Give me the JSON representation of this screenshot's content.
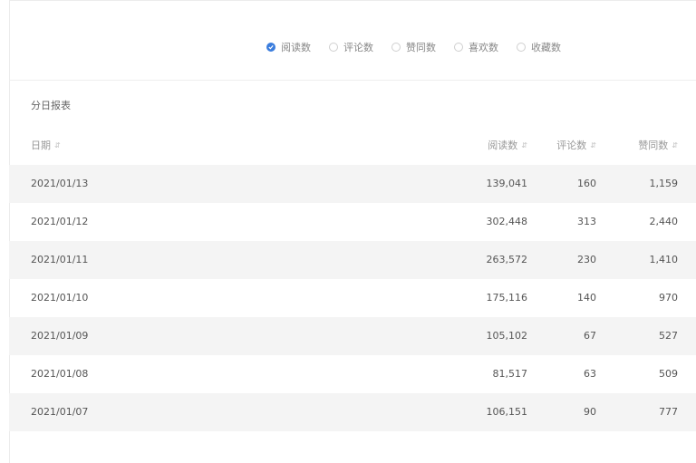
{
  "metrics": [
    {
      "label": "阅读数",
      "checked": true
    },
    {
      "label": "评论数",
      "checked": false
    },
    {
      "label": "赞同数",
      "checked": false
    },
    {
      "label": "喜欢数",
      "checked": false
    },
    {
      "label": "收藏数",
      "checked": false
    }
  ],
  "section_title": "分日报表",
  "table": {
    "headers": {
      "date": "日期",
      "reads": "阅读数",
      "comments": "评论数",
      "likes": "赞同数"
    },
    "sort_icon": "sort-icon",
    "rows": [
      {
        "date": "2021/01/13",
        "reads": "139,041",
        "comments": "160",
        "likes": "1,159"
      },
      {
        "date": "2021/01/12",
        "reads": "302,448",
        "comments": "313",
        "likes": "2,440"
      },
      {
        "date": "2021/01/11",
        "reads": "263,572",
        "comments": "230",
        "likes": "1,410"
      },
      {
        "date": "2021/01/10",
        "reads": "175,116",
        "comments": "140",
        "likes": "970"
      },
      {
        "date": "2021/01/09",
        "reads": "105,102",
        "comments": "67",
        "likes": "527"
      },
      {
        "date": "2021/01/08",
        "reads": "81,517",
        "comments": "63",
        "likes": "509"
      },
      {
        "date": "2021/01/07",
        "reads": "106,151",
        "comments": "90",
        "likes": "777"
      }
    ]
  },
  "colors": {
    "accent": "#3b7ddd",
    "stripe": "#f4f4f4"
  }
}
